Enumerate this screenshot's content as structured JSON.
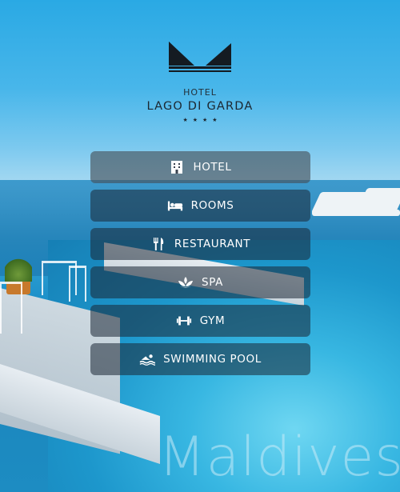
{
  "logo": {
    "icon": "hotel-m-logo-icon",
    "hotel_word": "HOTEL",
    "name": "LAGO DI GARDA",
    "stars": "★★★★"
  },
  "menu": {
    "items": [
      {
        "icon": "building-icon",
        "label": "HOTEL"
      },
      {
        "icon": "bed-icon",
        "label": "ROOMS"
      },
      {
        "icon": "fork-knife-icon",
        "label": "RESTAURANT"
      },
      {
        "icon": "lotus-icon",
        "label": "SPA"
      },
      {
        "icon": "dumbbell-icon",
        "label": "GYM"
      },
      {
        "icon": "swimmer-icon",
        "label": "SWIMMING POOL"
      }
    ]
  },
  "background": {
    "watermark": "Maldives"
  },
  "colors": {
    "button_bg": "#1a2634",
    "button_text": "#ffffff",
    "logo_text": "#1c2730"
  }
}
